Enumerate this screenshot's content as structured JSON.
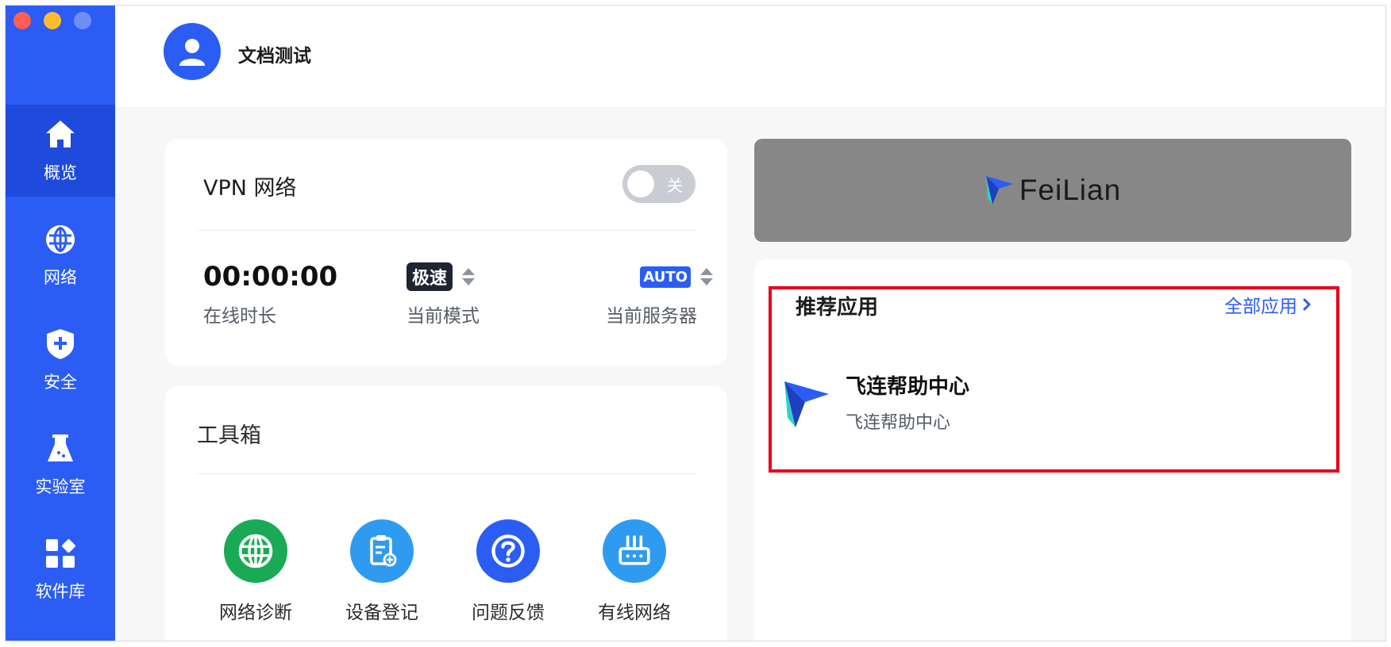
{
  "window": {
    "controls": [
      "close",
      "minimize",
      "zoom"
    ]
  },
  "sidebar": {
    "items": [
      {
        "label": "概览",
        "icon": "home-icon",
        "active": true
      },
      {
        "label": "网络",
        "icon": "globe-icon",
        "active": false
      },
      {
        "label": "安全",
        "icon": "shield-icon",
        "active": false
      },
      {
        "label": "实验室",
        "icon": "flask-icon",
        "active": false
      },
      {
        "label": "软件库",
        "icon": "apps-grid-icon",
        "active": false
      }
    ]
  },
  "header": {
    "username": "文档测试"
  },
  "vpn": {
    "title": "VPN 网络",
    "toggle_label": "关",
    "online_time": {
      "value": "00:00:00",
      "label": "在线时长"
    },
    "mode": {
      "value": "极速",
      "label": "当前模式"
    },
    "server": {
      "value": "AUTO",
      "label": "当前服务器"
    }
  },
  "toolbox": {
    "title": "工具箱",
    "tools": [
      {
        "label": "网络诊断",
        "icon": "globe-icon",
        "color": "#1aaa55"
      },
      {
        "label": "设备登记",
        "icon": "clipboard-add-icon",
        "color": "#2f9bf0"
      },
      {
        "label": "问题反馈",
        "icon": "question-icon",
        "color": "#2b5df5"
      },
      {
        "label": "有线网络",
        "icon": "router-icon",
        "color": "#2f9bf0"
      }
    ]
  },
  "banner": {
    "brand": "FeiLian"
  },
  "recommended": {
    "title": "推荐应用",
    "all_apps_label": "全部应用",
    "apps": [
      {
        "name": "飞连帮助中心",
        "description": "飞连帮助中心",
        "icon": "feilian-logo-icon"
      }
    ]
  },
  "colors": {
    "primary": "#2b5df5",
    "sidebar_active": "#1e4bdc",
    "highlight": "#e8001c"
  }
}
